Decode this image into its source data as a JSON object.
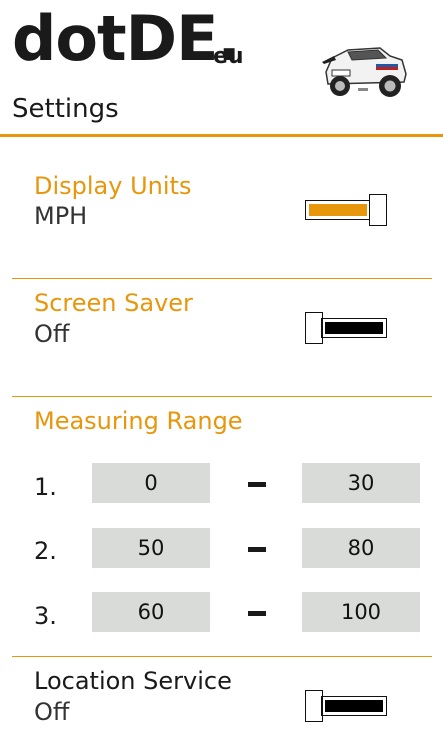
{
  "header": {
    "brand": "dotDE.",
    "brand_tld": "eu",
    "subtitle": "Settings"
  },
  "display_units": {
    "title": "Display Units",
    "value": "MPH",
    "toggle_on": true
  },
  "screen_saver": {
    "title": "Screen Saver",
    "value": "Off",
    "toggle_on": false
  },
  "measuring_range": {
    "title": "Measuring Range",
    "rows": [
      {
        "label": "1.",
        "from": "0",
        "to": "30"
      },
      {
        "label": "2.",
        "from": "50",
        "to": "80"
      },
      {
        "label": "3.",
        "from": "60",
        "to": "100"
      }
    ]
  },
  "location_service": {
    "title": "Location Service",
    "value": "Off",
    "toggle_on": false
  },
  "colors": {
    "accent": "#e8960c",
    "input_bg": "#d8dbd8"
  }
}
